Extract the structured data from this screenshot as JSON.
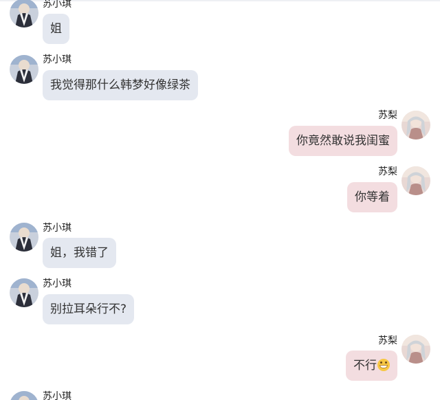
{
  "colors": {
    "left_bubble": "#e4e8f0",
    "right_bubble": "#f3dde0",
    "background": "#ffffff"
  },
  "messages": [
    {
      "side": "left",
      "sender": "苏小琪",
      "text": "姐",
      "avatar_icon": "avatar-icon"
    },
    {
      "side": "left",
      "sender": "苏小琪",
      "text": "我觉得那什么韩梦好像绿茶",
      "avatar_icon": "avatar-icon"
    },
    {
      "side": "right",
      "sender": "苏梨",
      "text": "你竟然敢说我闺蜜",
      "avatar_icon": "avatar-icon"
    },
    {
      "side": "right",
      "sender": "苏梨",
      "text": "你等着",
      "avatar_icon": "avatar-icon"
    },
    {
      "side": "left",
      "sender": "苏小琪",
      "text": "姐，我错了",
      "avatar_icon": "avatar-icon"
    },
    {
      "side": "left",
      "sender": "苏小琪",
      "text": "别拉耳朵行不?",
      "avatar_icon": "avatar-icon"
    },
    {
      "side": "right",
      "sender": "苏梨",
      "text": "不行",
      "emoji": "grinning-emoji-icon",
      "avatar_icon": "avatar-icon"
    },
    {
      "side": "left",
      "sender": "苏小琪",
      "text": "",
      "avatar_icon": "avatar-icon"
    }
  ]
}
